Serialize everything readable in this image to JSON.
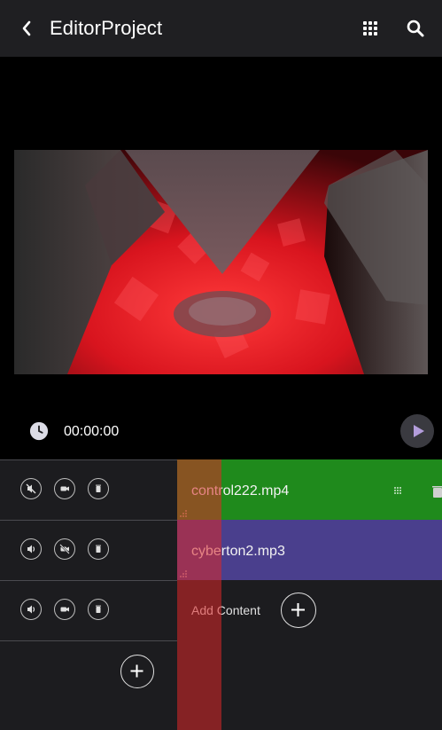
{
  "appbar": {
    "title": "EditorProject",
    "back_icon": "chevron-left-icon",
    "grid_icon": "apps-grid-icon",
    "search_icon": "search-icon"
  },
  "player": {
    "current_time": "00:00:00",
    "clock_icon": "clock-icon",
    "play_icon": "play-icon"
  },
  "tracks": [
    {
      "controls": [
        "volume-muted-icon",
        "camera-icon",
        "delete-icon"
      ]
    },
    {
      "controls": [
        "volume-icon",
        "camera-off-icon",
        "delete-icon"
      ]
    },
    {
      "controls": [
        "volume-icon",
        "camera-icon",
        "delete-icon"
      ]
    }
  ],
  "clips": [
    {
      "label": "control222.mp4",
      "color": "#1f8a1c"
    },
    {
      "label": "cyberton2.mp3",
      "color": "#4a3f8d"
    }
  ],
  "add_content": {
    "label": "Add Content"
  },
  "colors": {
    "playhead": "#dc2828",
    "accent_play": "#b39ddb"
  }
}
